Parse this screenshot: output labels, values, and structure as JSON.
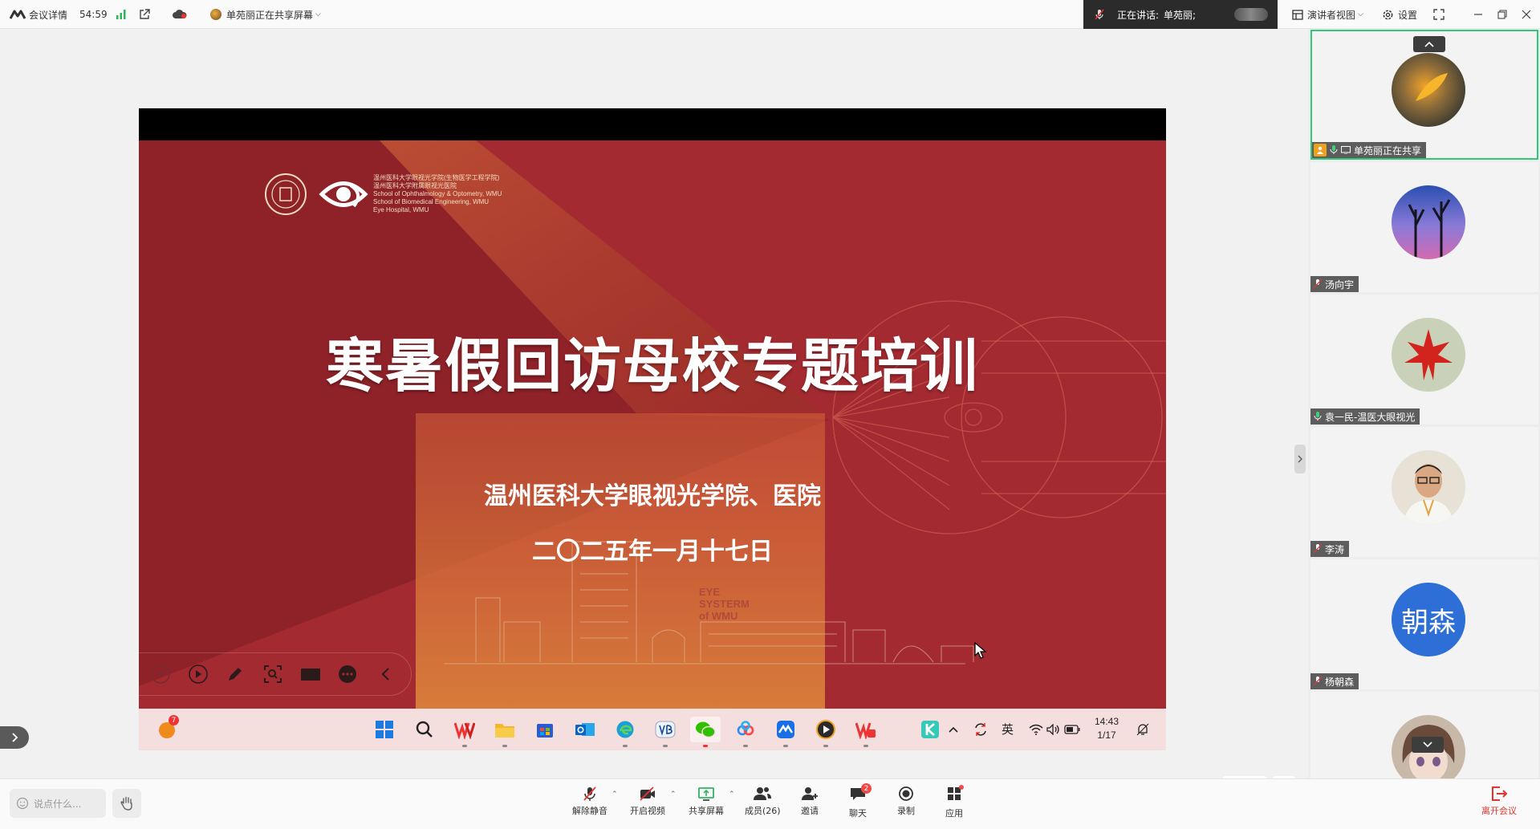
{
  "topbar": {
    "meeting_info_label": "会议详情",
    "timer": "54:59",
    "sharing_status": "单苑丽正在共享屏幕",
    "speaking_label": "正在讲话:",
    "speaking_name": "单苑丽;",
    "view_mode_label": "演讲者视图",
    "settings_label": "设置"
  },
  "slide": {
    "logo_line1": "温州医科大学眼视光学院(生物医学工程学院)",
    "logo_line2": "温州医科大学附属眼视光医院",
    "logo_line3": "School of Ophthalmology & Optometry, WMU",
    "logo_line4": "School of Biomedical Engineering, WMU",
    "logo_line5": "Eye Hospital, WMU",
    "title": "寒暑假回访母校专题培训",
    "subtitle": "温州医科大学眼视光学院、医院",
    "date": "二〇二五年一月十七日",
    "eye_line1": "EYE",
    "eye_line2": "SYSTERM",
    "eye_line3": "of WMU"
  },
  "taskbar": {
    "notification_count": "7",
    "language": "英",
    "time": "14:43",
    "date": "1/17"
  },
  "share_tools": {
    "annotate_label": "批注"
  },
  "participants": [
    {
      "name": "单苑丽正在共享",
      "active": true
    },
    {
      "name": "汤向宇"
    },
    {
      "name": "袁一民-温医大眼视光"
    },
    {
      "name": "李涛"
    },
    {
      "name": "杨朝森",
      "avatar_text": "朝森",
      "avatar_color": "#2d6fd6"
    },
    {
      "name": ""
    }
  ],
  "bottombar": {
    "chat_placeholder": "说点什么...",
    "unmute_label": "解除静音",
    "video_label": "开启视频",
    "share_label": "共享屏幕",
    "members_label": "成员(26)",
    "invite_label": "邀请",
    "chat_label": "聊天",
    "chat_badge": "2",
    "record_label": "录制",
    "apps_label": "应用",
    "leave_label": "离开会议"
  },
  "colors": {
    "slide_red": "#a32a30",
    "active_border": "#2fc87a",
    "leave_red": "#e0352b"
  }
}
